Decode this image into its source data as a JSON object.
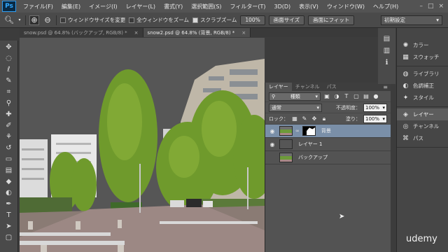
{
  "menubar": {
    "logo": "Ps",
    "items": [
      "ファイル(F)",
      "編集(E)",
      "イメージ(I)",
      "レイヤー(L)",
      "書式(Y)",
      "選択範囲(S)",
      "フィルター(T)",
      "3D(D)",
      "表示(V)",
      "ウィンドウ(W)",
      "ヘルプ(H)"
    ],
    "window_controls": [
      "–",
      "□",
      "×"
    ]
  },
  "options": {
    "check_resize": "ウィンドウサイズを変更",
    "check_all_windows": "全ウィンドウをズーム",
    "check_scrubby": "スクラブズーム",
    "btn_100": "100%",
    "btn_screen": "画面サイズ",
    "btn_fill": "画面にフィット",
    "workspace": "初期設定"
  },
  "tabs": [
    {
      "label": "snow.psd @ 64.8% (バックアップ, RGB/8) *",
      "close": "×"
    },
    {
      "label": "snow2.psd @ 64.8% (背景, RGB/8) *",
      "close": "×"
    }
  ],
  "layers": {
    "tabs": [
      "レイヤー",
      "チャンネル",
      "パス"
    ],
    "kind": "種類",
    "blend_mode": "通常",
    "opacity_label": "不透明度：",
    "opacity_value": "100%",
    "lock_label": "ロック：",
    "fill_label": "塗り：",
    "fill_value": "100%",
    "items": [
      {
        "name": "背景",
        "visible": true
      },
      {
        "name": "レイヤー 1",
        "visible": true
      },
      {
        "name": "バックアップ",
        "visible": false
      }
    ]
  },
  "dock": {
    "group1": [
      "カラー",
      "スウォッチ"
    ],
    "group2": [
      "ライブラリ",
      "色調補正",
      "スタイル"
    ],
    "group3": [
      "レイヤー",
      "チャンネル",
      "パス"
    ]
  },
  "watermark": "udemy"
}
